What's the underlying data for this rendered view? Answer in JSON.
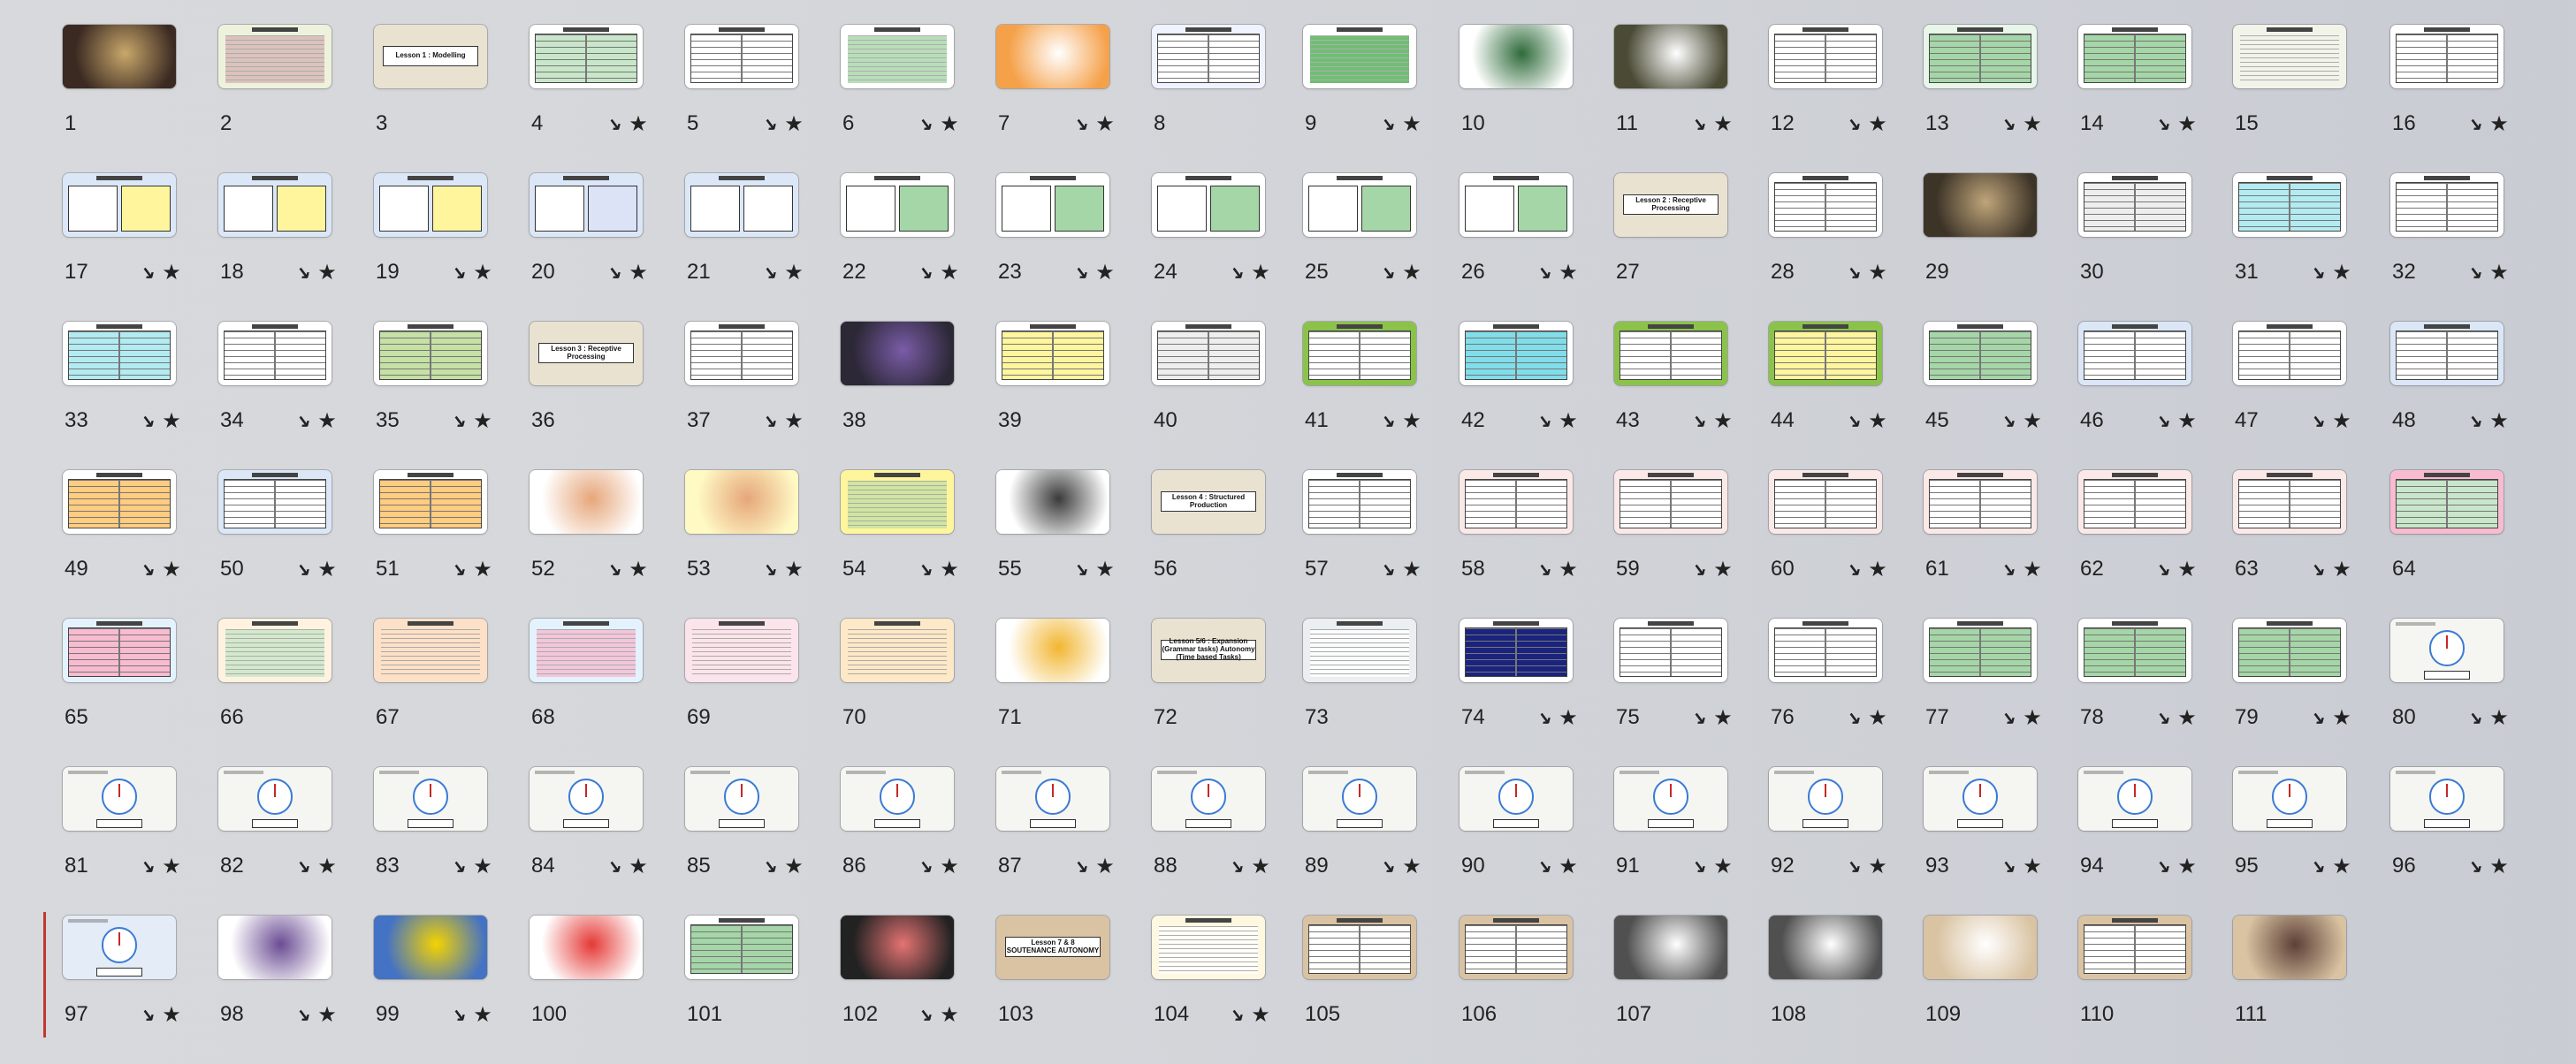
{
  "slides": [
    {
      "n": "1",
      "k": "img",
      "bg": "#3b2a22",
      "accent": "#c9a86b",
      "anim": false
    },
    {
      "n": "2",
      "k": "text",
      "bg": "#eef2dc",
      "accent": "#d8b6b6",
      "anim": false
    },
    {
      "n": "3",
      "k": "title",
      "bg": "#e9e2d1",
      "accent": "#e9e2d1",
      "title": "Lesson 1 : Modelling",
      "anim": false
    },
    {
      "n": "4",
      "k": "table",
      "bg": "#ffffff",
      "accent": "#c8e6c9",
      "anim": true
    },
    {
      "n": "5",
      "k": "table",
      "bg": "#ffffff",
      "accent": "#ffffff",
      "anim": true
    },
    {
      "n": "6",
      "k": "text",
      "bg": "#ffffff",
      "accent": "#a5d6a7",
      "anim": true
    },
    {
      "n": "7",
      "k": "img",
      "bg": "#f5a14a",
      "accent": "#ffffff",
      "anim": true
    },
    {
      "n": "8",
      "k": "table",
      "bg": "#eef3ff",
      "accent": "#ffffff",
      "anim": false
    },
    {
      "n": "9",
      "k": "text",
      "bg": "#ffffff",
      "accent": "#4caf50",
      "anim": true
    },
    {
      "n": "10",
      "k": "img",
      "bg": "#ffffff",
      "accent": "#2e6b3a",
      "anim": false
    },
    {
      "n": "11",
      "k": "img",
      "bg": "#4a4a35",
      "accent": "#ffffff",
      "anim": true
    },
    {
      "n": "12",
      "k": "table",
      "bg": "#ffffff",
      "accent": "#ffffff",
      "anim": true
    },
    {
      "n": "13",
      "k": "table",
      "bg": "#e8f5e9",
      "accent": "#a5d6a7",
      "anim": true
    },
    {
      "n": "14",
      "k": "table",
      "bg": "#ffffff",
      "accent": "#a5d6a7",
      "anim": true
    },
    {
      "n": "15",
      "k": "text",
      "bg": "#f2f4ea",
      "accent": "#f2f4ea",
      "anim": false
    },
    {
      "n": "16",
      "k": "table",
      "bg": "#ffffff",
      "accent": "#ffffff",
      "anim": true
    },
    {
      "n": "17",
      "k": "big",
      "bg": "#dbe7f7",
      "accent": "#fff59d",
      "anim": true
    },
    {
      "n": "18",
      "k": "big",
      "bg": "#dbe7f7",
      "accent": "#fff59d",
      "anim": true
    },
    {
      "n": "19",
      "k": "big",
      "bg": "#dbe7f7",
      "accent": "#fff59d",
      "anim": true
    },
    {
      "n": "20",
      "k": "big",
      "bg": "#dbe7f7",
      "accent": "#dce3f7",
      "anim": true
    },
    {
      "n": "21",
      "k": "big",
      "bg": "#dbe7f7",
      "accent": "#ffffff",
      "anim": true
    },
    {
      "n": "22",
      "k": "big",
      "bg": "#ffffff",
      "accent": "#a5d6a7",
      "anim": true
    },
    {
      "n": "23",
      "k": "big",
      "bg": "#ffffff",
      "accent": "#a5d6a7",
      "anim": true
    },
    {
      "n": "24",
      "k": "big",
      "bg": "#ffffff",
      "accent": "#a5d6a7",
      "anim": true
    },
    {
      "n": "25",
      "k": "big",
      "bg": "#ffffff",
      "accent": "#a5d6a7",
      "anim": true
    },
    {
      "n": "26",
      "k": "big",
      "bg": "#ffffff",
      "accent": "#a5d6a7",
      "anim": true
    },
    {
      "n": "27",
      "k": "title",
      "bg": "#e9e2d1",
      "accent": "#e9e2d1",
      "title": "Lesson 2 : Receptive Processing",
      "anim": false
    },
    {
      "n": "28",
      "k": "table",
      "bg": "#ffffff",
      "accent": "#ffffff",
      "anim": true
    },
    {
      "n": "29",
      "k": "img",
      "bg": "#3d3428",
      "accent": "#bfa57a",
      "anim": false
    },
    {
      "n": "30",
      "k": "table",
      "bg": "#ffffff",
      "accent": "#eeeeee",
      "anim": false
    },
    {
      "n": "31",
      "k": "table",
      "bg": "#ffffff",
      "accent": "#b2ebf2",
      "anim": true
    },
    {
      "n": "32",
      "k": "table",
      "bg": "#ffffff",
      "accent": "#ffffff",
      "anim": true
    },
    {
      "n": "33",
      "k": "table",
      "bg": "#ffffff",
      "accent": "#b2ebf2",
      "anim": true
    },
    {
      "n": "34",
      "k": "table",
      "bg": "#ffffff",
      "accent": "#ffffff",
      "anim": true
    },
    {
      "n": "35",
      "k": "table",
      "bg": "#ffffff",
      "accent": "#c5e1a5",
      "anim": true
    },
    {
      "n": "36",
      "k": "title",
      "bg": "#e9e2d1",
      "accent": "#e9e2d1",
      "title": "Lesson 3 : Receptive Processing",
      "anim": false
    },
    {
      "n": "37",
      "k": "table",
      "bg": "#ffffff",
      "accent": "#ffffff",
      "anim": true
    },
    {
      "n": "38",
      "k": "img",
      "bg": "#2c2836",
      "accent": "#7a5ca8",
      "anim": false
    },
    {
      "n": "39",
      "k": "table",
      "bg": "#ffffff",
      "accent": "#fff59d",
      "anim": false
    },
    {
      "n": "40",
      "k": "table",
      "bg": "#ffffff",
      "accent": "#eeeeee",
      "anim": false
    },
    {
      "n": "41",
      "k": "table",
      "bg": "#8bc34a",
      "accent": "#ffffff",
      "anim": true
    },
    {
      "n": "42",
      "k": "table",
      "bg": "#ffffff",
      "accent": "#80deea",
      "anim": true
    },
    {
      "n": "43",
      "k": "table",
      "bg": "#8bc34a",
      "accent": "#ffffff",
      "anim": true
    },
    {
      "n": "44",
      "k": "table",
      "bg": "#8bc34a",
      "accent": "#fff59d",
      "anim": true
    },
    {
      "n": "45",
      "k": "table",
      "bg": "#ffffff",
      "accent": "#a5d6a7",
      "anim": true
    },
    {
      "n": "46",
      "k": "table",
      "bg": "#dbe7f7",
      "accent": "#ffffff",
      "anim": true
    },
    {
      "n": "47",
      "k": "table",
      "bg": "#ffffff",
      "accent": "#ffffff",
      "anim": true
    },
    {
      "n": "48",
      "k": "table",
      "bg": "#dbe7f7",
      "accent": "#ffffff",
      "anim": true
    },
    {
      "n": "49",
      "k": "table",
      "bg": "#ffffff",
      "accent": "#ffcc80",
      "anim": true
    },
    {
      "n": "50",
      "k": "table",
      "bg": "#dbe7f7",
      "accent": "#ffffff",
      "anim": true
    },
    {
      "n": "51",
      "k": "table",
      "bg": "#ffffff",
      "accent": "#ffcc80",
      "anim": true
    },
    {
      "n": "52",
      "k": "img",
      "bg": "#ffffff",
      "accent": "#e6a67a",
      "anim": true
    },
    {
      "n": "53",
      "k": "img",
      "bg": "#fff9c4",
      "accent": "#e6a67a",
      "anim": true
    },
    {
      "n": "54",
      "k": "text",
      "bg": "#fff59d",
      "accent": "#c5e1a5",
      "anim": true
    },
    {
      "n": "55",
      "k": "img",
      "bg": "#ffffff",
      "accent": "#3a3a3a",
      "anim": true
    },
    {
      "n": "56",
      "k": "title",
      "bg": "#e9e2d1",
      "accent": "#e9e2d1",
      "title": "Lesson 4 : Structured Production",
      "anim": false
    },
    {
      "n": "57",
      "k": "table",
      "bg": "#ffffff",
      "accent": "#ffffff",
      "anim": true
    },
    {
      "n": "58",
      "k": "table",
      "bg": "#fbe9e7",
      "accent": "#ffffff",
      "anim": true
    },
    {
      "n": "59",
      "k": "table",
      "bg": "#fbe9e7",
      "accent": "#ffffff",
      "anim": true
    },
    {
      "n": "60",
      "k": "table",
      "bg": "#fbe9e7",
      "accent": "#ffffff",
      "anim": true
    },
    {
      "n": "61",
      "k": "table",
      "bg": "#fbe9e7",
      "accent": "#ffffff",
      "anim": true
    },
    {
      "n": "62",
      "k": "table",
      "bg": "#fbe9e7",
      "accent": "#ffffff",
      "anim": true
    },
    {
      "n": "63",
      "k": "table",
      "bg": "#fbe9e7",
      "accent": "#ffffff",
      "anim": true
    },
    {
      "n": "64",
      "k": "table",
      "bg": "#f8bbd0",
      "accent": "#c8e6c9",
      "anim": false
    },
    {
      "n": "65",
      "k": "table",
      "bg": "#e3f2fd",
      "accent": "#f8bbd0",
      "anim": false
    },
    {
      "n": "66",
      "k": "text",
      "bg": "#fff3e0",
      "accent": "#c8e6c9",
      "anim": false
    },
    {
      "n": "67",
      "k": "text",
      "bg": "#fde0c8",
      "accent": "#fde0c8",
      "anim": false
    },
    {
      "n": "68",
      "k": "text",
      "bg": "#e3f2fd",
      "accent": "#f8bbd0",
      "anim": false
    },
    {
      "n": "69",
      "k": "text",
      "bg": "#fce4ec",
      "accent": "#fce4ec",
      "anim": false
    },
    {
      "n": "70",
      "k": "text",
      "bg": "#fde8c8",
      "accent": "#fde8c8",
      "anim": false
    },
    {
      "n": "71",
      "k": "img",
      "bg": "#ffffff",
      "accent": "#f2b631",
      "anim": false
    },
    {
      "n": "72",
      "k": "title",
      "bg": "#e9e2d1",
      "accent": "#e9e2d1",
      "title": "Lesson 5/6 : Expansion (Grammar tasks) Autonomy (Time based Tasks)",
      "anim": false
    },
    {
      "n": "73",
      "k": "text",
      "bg": "#eceff1",
      "accent": "#ffffff",
      "anim": false
    },
    {
      "n": "74",
      "k": "table",
      "bg": "#ffffff",
      "accent": "#1a237e",
      "anim": true
    },
    {
      "n": "75",
      "k": "table",
      "bg": "#ffffff",
      "accent": "#ffffff",
      "anim": true
    },
    {
      "n": "76",
      "k": "table",
      "bg": "#ffffff",
      "accent": "#ffffff",
      "anim": true
    },
    {
      "n": "77",
      "k": "table",
      "bg": "#ffffff",
      "accent": "#a5d6a7",
      "anim": true
    },
    {
      "n": "78",
      "k": "table",
      "bg": "#ffffff",
      "accent": "#a5d6a7",
      "anim": true
    },
    {
      "n": "79",
      "k": "table",
      "bg": "#ffffff",
      "accent": "#a5d6a7",
      "anim": true
    },
    {
      "n": "80",
      "k": "clock",
      "bg": "#f5f5f2",
      "accent": "#3a7bd5",
      "anim": true
    },
    {
      "n": "81",
      "k": "clock",
      "bg": "#f5f5f2",
      "accent": "#3a7bd5",
      "anim": true
    },
    {
      "n": "82",
      "k": "clock",
      "bg": "#f5f5f2",
      "accent": "#3a7bd5",
      "anim": true
    },
    {
      "n": "83",
      "k": "clock",
      "bg": "#f5f5f2",
      "accent": "#3a7bd5",
      "anim": true
    },
    {
      "n": "84",
      "k": "clock",
      "bg": "#f5f5f2",
      "accent": "#3a7bd5",
      "anim": true
    },
    {
      "n": "85",
      "k": "clock",
      "bg": "#f5f5f2",
      "accent": "#3a7bd5",
      "anim": true
    },
    {
      "n": "86",
      "k": "clock",
      "bg": "#f5f5f2",
      "accent": "#3a7bd5",
      "anim": true
    },
    {
      "n": "87",
      "k": "clock",
      "bg": "#f5f5f2",
      "accent": "#3a7bd5",
      "anim": true
    },
    {
      "n": "88",
      "k": "clock",
      "bg": "#f5f5f2",
      "accent": "#3a7bd5",
      "anim": true
    },
    {
      "n": "89",
      "k": "clock",
      "bg": "#f5f5f2",
      "accent": "#3a7bd5",
      "anim": true
    },
    {
      "n": "90",
      "k": "clock",
      "bg": "#f5f5f2",
      "accent": "#3a7bd5",
      "anim": true
    },
    {
      "n": "91",
      "k": "clock",
      "bg": "#f5f5f2",
      "accent": "#3a7bd5",
      "anim": true
    },
    {
      "n": "92",
      "k": "clock",
      "bg": "#f5f5f2",
      "accent": "#3a7bd5",
      "anim": true
    },
    {
      "n": "93",
      "k": "clock",
      "bg": "#f5f5f2",
      "accent": "#3a7bd5",
      "anim": true
    },
    {
      "n": "94",
      "k": "clock",
      "bg": "#f5f5f2",
      "accent": "#3a7bd5",
      "anim": true
    },
    {
      "n": "95",
      "k": "clock",
      "bg": "#f5f5f2",
      "accent": "#3a7bd5",
      "anim": true
    },
    {
      "n": "96",
      "k": "clock",
      "bg": "#f5f5f2",
      "accent": "#3a7bd5",
      "anim": true
    },
    {
      "n": "97",
      "k": "clock",
      "bg": "#e3ecf7",
      "accent": "#3a7bd5",
      "anim": true
    },
    {
      "n": "98",
      "k": "img",
      "bg": "#ffffff",
      "accent": "#6a4c93",
      "anim": true
    },
    {
      "n": "99",
      "k": "img",
      "bg": "#4472c4",
      "accent": "#f5d300",
      "anim": true
    },
    {
      "n": "100",
      "k": "img",
      "bg": "#ffffff",
      "accent": "#e53935",
      "anim": false
    },
    {
      "n": "101",
      "k": "table",
      "bg": "#ffffff",
      "accent": "#a5d6a7",
      "anim": false
    },
    {
      "n": "102",
      "k": "img",
      "bg": "#222222",
      "accent": "#e57373",
      "anim": true
    },
    {
      "n": "103",
      "k": "title",
      "bg": "#d9c3a2",
      "accent": "#d9c3a2",
      "title": "Lesson 7 & 8 SOUTENANCE AUTONOMY",
      "anim": false
    },
    {
      "n": "104",
      "k": "text",
      "bg": "#fff8e1",
      "accent": "#ffffff",
      "anim": true
    },
    {
      "n": "105",
      "k": "table",
      "bg": "#d9c3a2",
      "accent": "#ffffff",
      "anim": false
    },
    {
      "n": "106",
      "k": "table",
      "bg": "#d9c3a2",
      "accent": "#ffffff",
      "anim": false
    },
    {
      "n": "107",
      "k": "img",
      "bg": "#505050",
      "accent": "#ffffff",
      "anim": false
    },
    {
      "n": "108",
      "k": "img",
      "bg": "#505050",
      "accent": "#ffffff",
      "anim": false
    },
    {
      "n": "109",
      "k": "img",
      "bg": "#d9c3a2",
      "accent": "#ffffff",
      "anim": false
    },
    {
      "n": "110",
      "k": "table",
      "bg": "#d9c3a2",
      "accent": "#ffffff",
      "anim": false
    },
    {
      "n": "111",
      "k": "img",
      "bg": "#d9c3a2",
      "accent": "#5d4037",
      "anim": false
    }
  ],
  "icons": {
    "animation": "animation-icon",
    "favorite": "star-icon"
  },
  "glyphs": {
    "animation": "↘",
    "favorite": "★"
  },
  "colors": {
    "selection_bar": "#c0392b"
  }
}
